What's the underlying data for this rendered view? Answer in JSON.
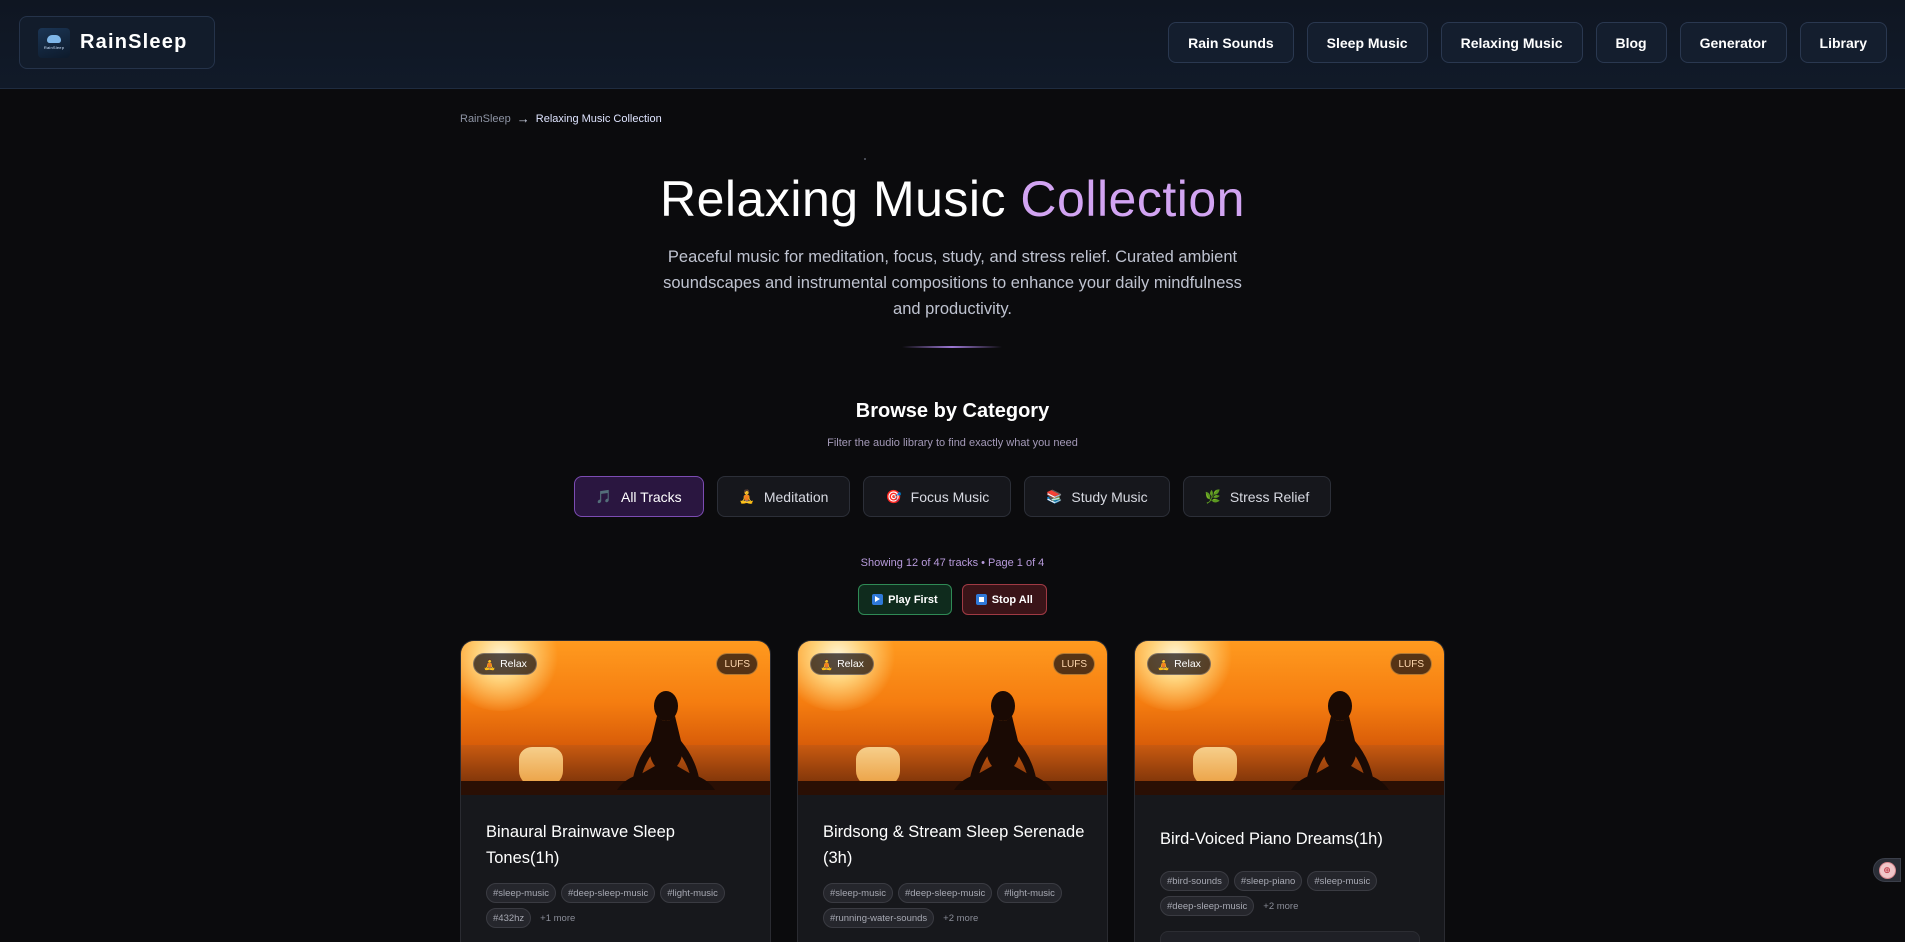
{
  "header": {
    "logo_image_text": "RainSleep",
    "brand": "RainSleep",
    "nav": [
      {
        "label": "Rain Sounds"
      },
      {
        "label": "Sleep Music"
      },
      {
        "label": "Relaxing Music"
      },
      {
        "label": "Blog"
      },
      {
        "label": "Generator"
      },
      {
        "label": "Library"
      }
    ]
  },
  "breadcrumb": {
    "home": "RainSleep",
    "separator": "→",
    "current": "Relaxing Music Collection"
  },
  "hero": {
    "title_main": "Relaxing Music ",
    "title_accent": "Collection",
    "description": "Peaceful music for meditation, focus, study, and stress relief. Curated ambient soundscapes and instrumental compositions to enhance your daily mindfulness and productivity."
  },
  "category": {
    "title": "Browse by Category",
    "subtitle": "Filter the audio library to find exactly what you need",
    "filters": [
      {
        "icon": "🎵",
        "icon_name": "music-note-icon",
        "label": "All Tracks",
        "active": true
      },
      {
        "icon": "🧘",
        "icon_name": "meditation-icon",
        "label": "Meditation",
        "active": false
      },
      {
        "icon": "🎯",
        "icon_name": "target-icon",
        "label": "Focus Music",
        "active": false
      },
      {
        "icon": "📚",
        "icon_name": "books-icon",
        "label": "Study Music",
        "active": false
      },
      {
        "icon": "🌿",
        "icon_name": "herb-icon",
        "label": "Stress Relief",
        "active": false
      }
    ]
  },
  "status": {
    "text": "Showing 12 of 47 tracks • Page 1 of 4",
    "play_label": "Play First",
    "stop_label": "Stop All"
  },
  "cards": [
    {
      "badge_icon": "🧘",
      "badge": "Relax",
      "lufs": "LUFS",
      "title": "Binaural Brainwave Sleep Tones(1h)",
      "tags": [
        "#sleep-music",
        "#deep-sleep-music",
        "#light-music",
        "#432hz"
      ],
      "more": "+1 more"
    },
    {
      "badge_icon": "🧘",
      "badge": "Relax",
      "lufs": "LUFS",
      "title": "Birdsong & Stream Sleep Serenade (3h)",
      "tags": [
        "#sleep-music",
        "#deep-sleep-music",
        "#light-music",
        "#running-water-sounds"
      ],
      "more": "+2 more"
    },
    {
      "badge_icon": "🧘",
      "badge": "Relax",
      "lufs": "LUFS",
      "title": "Bird-Voiced Piano Dreams(1h)",
      "tags": [
        "#bird-sounds",
        "#sleep-piano",
        "#sleep-music",
        "#deep-sleep-music"
      ],
      "more": "+2 more"
    }
  ],
  "colors": {
    "accent_purple": "#d2a4f2",
    "header_bg": "#111a29",
    "page_bg": "#0b0b0d",
    "play_green": "#2f8a55",
    "stop_red": "#a03a44"
  }
}
